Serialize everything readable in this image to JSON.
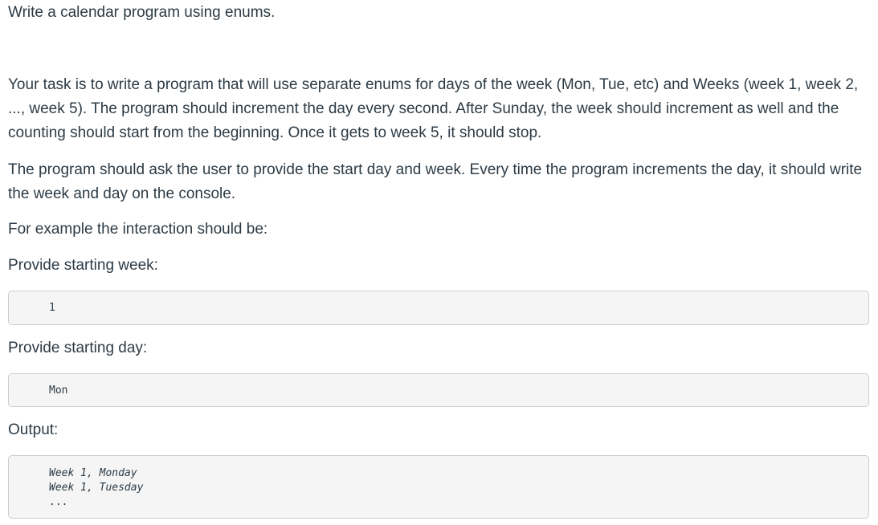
{
  "title": "Write a calendar program using enums.",
  "paragraphs": {
    "task": "Your task is to write a program that will use separate enums for days of the week (Mon, Tue, etc) and Weeks (week 1, week 2, ..., week 5). The program should increment the day every second. After Sunday, the week should increment as well and the counting should start from the beginning. Once it gets to week 5, it should stop.",
    "ask": "The program should ask the user to provide the start day and week. Every time the program increments the day, it should write the week and day on the console.",
    "example_intro": "For example the interaction should be:",
    "prompt_week": "Provide starting week:",
    "prompt_day": "Provide starting day:",
    "output_label": "Output:"
  },
  "code_blocks": {
    "week_value": "1",
    "day_value": "Mon",
    "output_lines": [
      "Week 1, Monday",
      "Week 1, Tuesday",
      "..."
    ]
  }
}
